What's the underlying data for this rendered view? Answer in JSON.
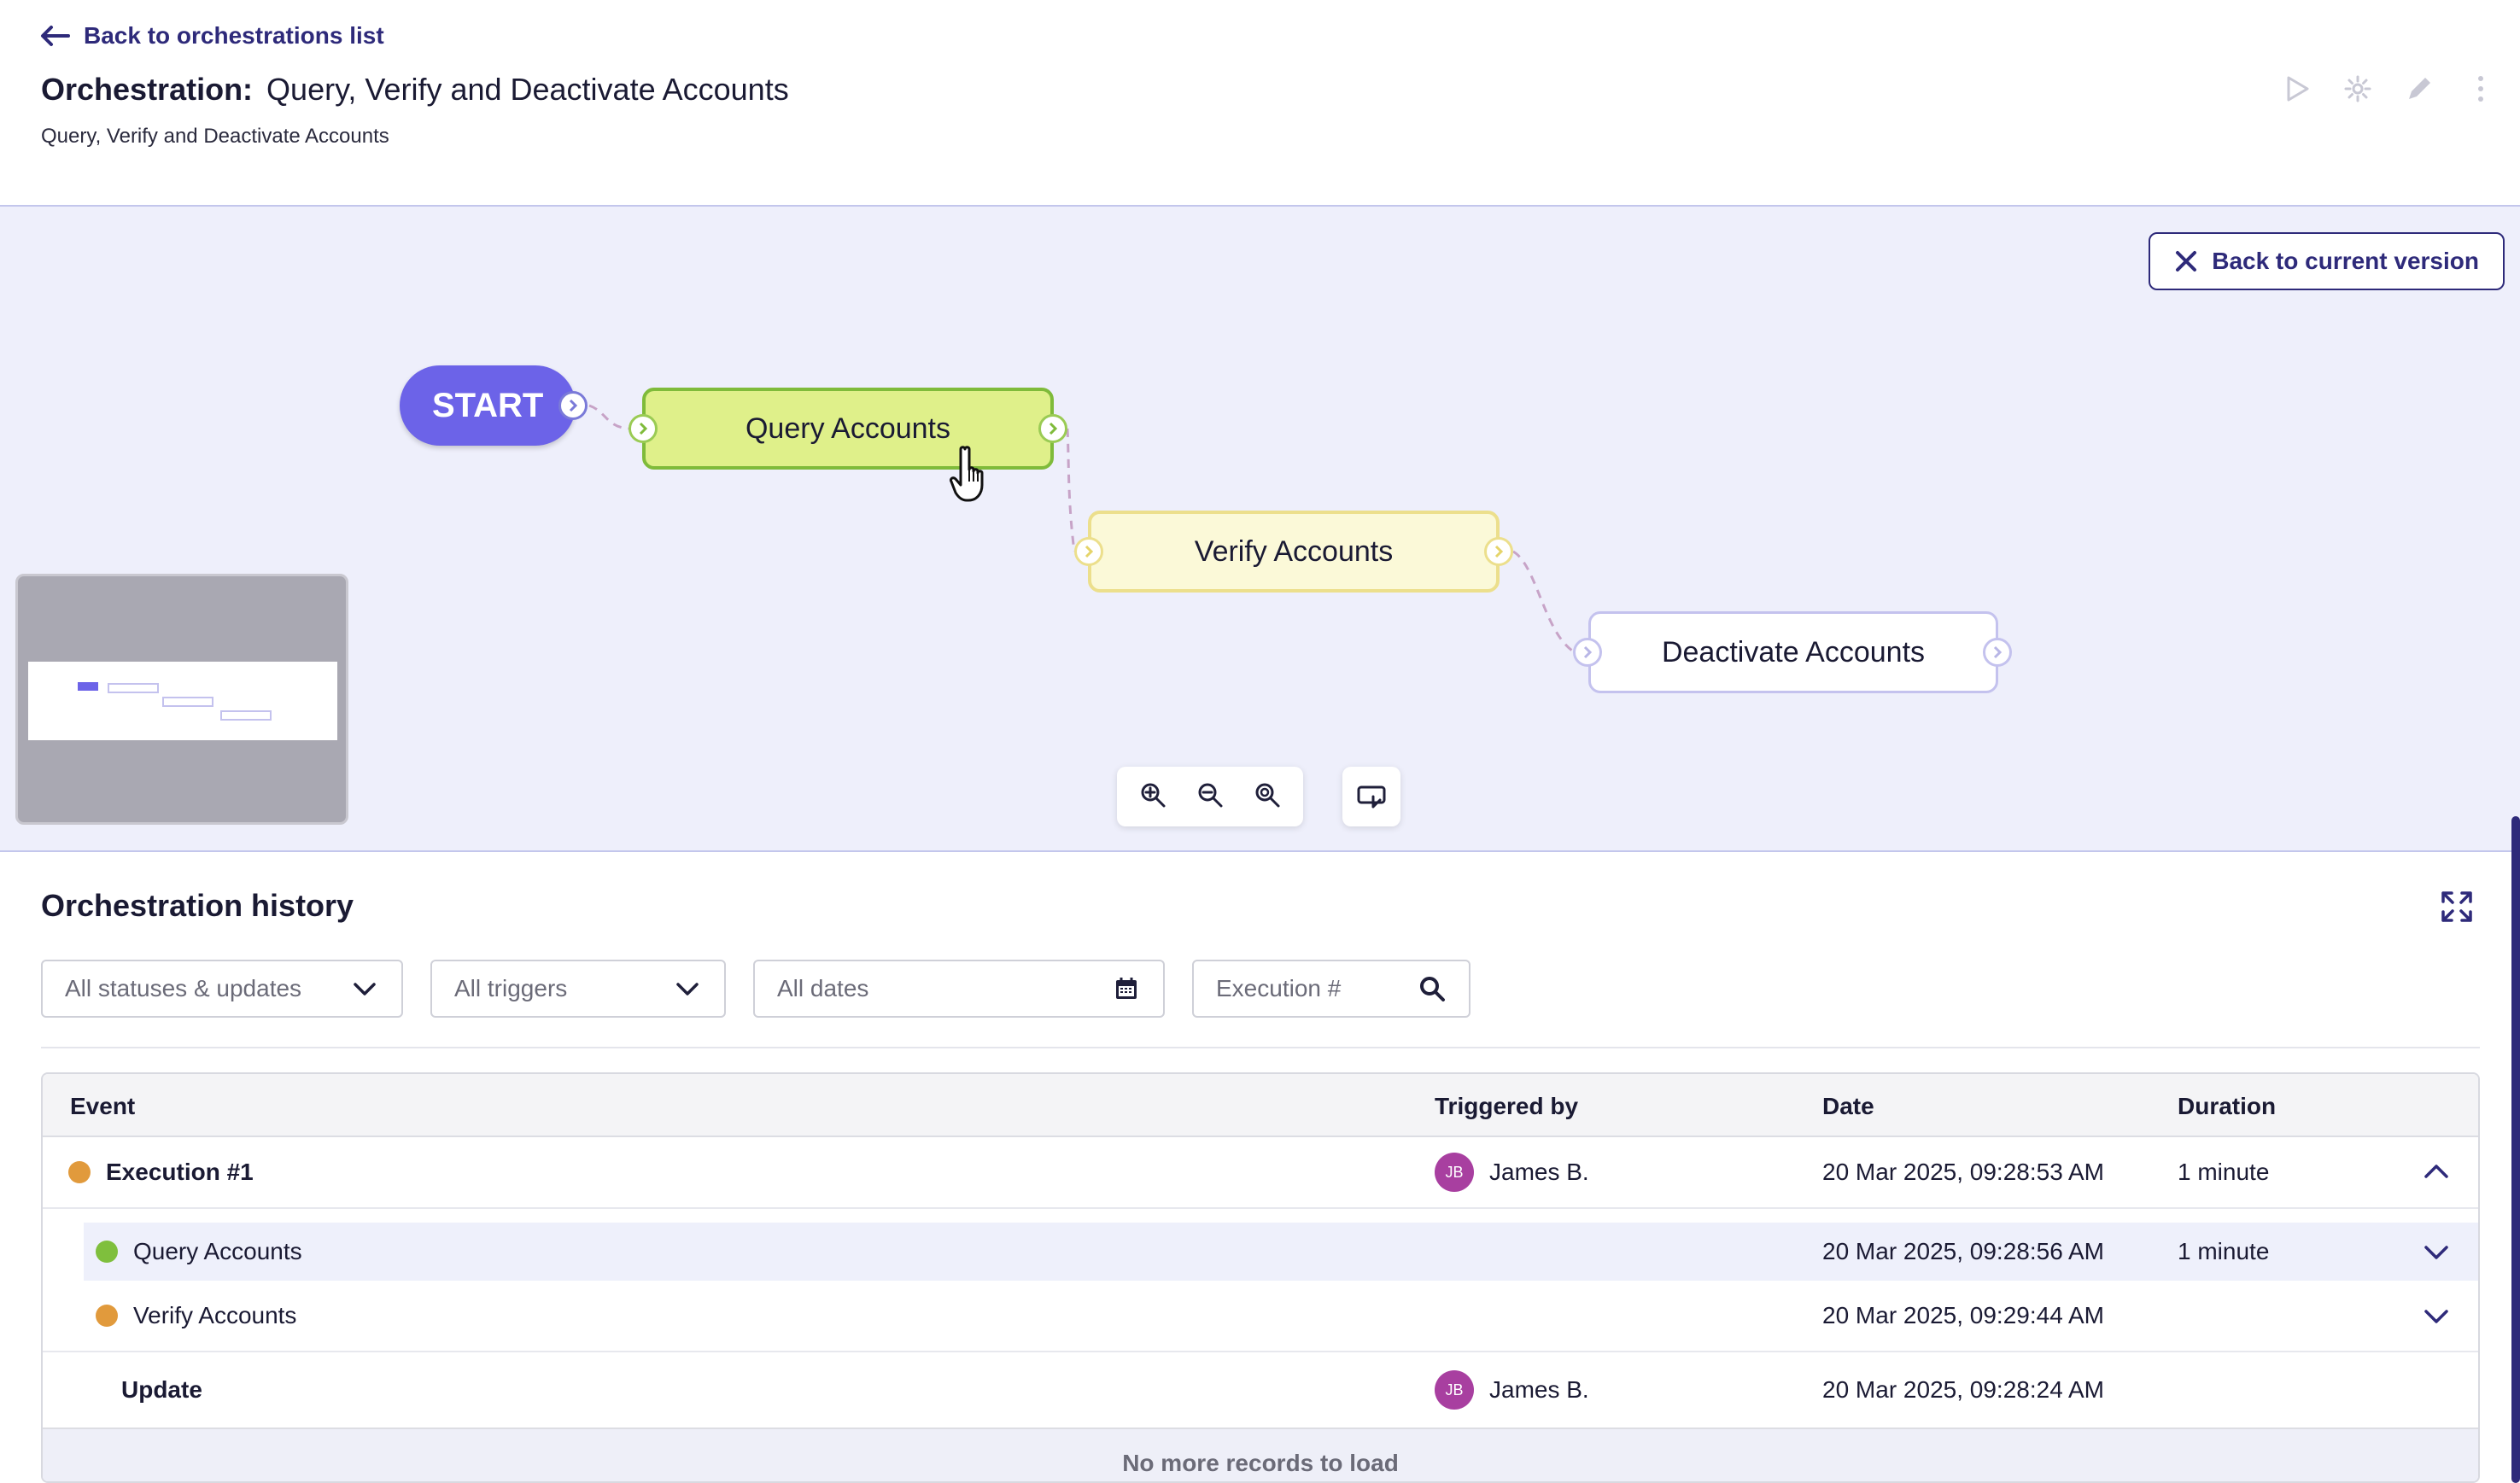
{
  "header": {
    "back_label": "Back to orchestrations list",
    "title_label": "Orchestration:",
    "title_value": "Query, Verify and Deactivate Accounts",
    "subtitle": "Query, Verify and Deactivate Accounts",
    "actions": [
      "play-icon",
      "gear-icon",
      "pencil-icon",
      "more-vertical-icon"
    ]
  },
  "canvas": {
    "back_version_label": "Back to current version",
    "start_label": "START",
    "nodes": [
      {
        "label": "Query Accounts",
        "status": "success",
        "color": "#dff08a"
      },
      {
        "label": "Verify Accounts",
        "status": "running",
        "color": "#fbf9d8"
      },
      {
        "label": "Deactivate Accounts",
        "status": "pending",
        "color": "#ffffff"
      }
    ],
    "zoom_controls": [
      "zoom-in-icon",
      "zoom-out-icon",
      "zoom-reset-icon"
    ],
    "fit_control": "fit-screen-icon"
  },
  "history": {
    "title": "Orchestration history",
    "filters": {
      "status": "All statuses & updates",
      "triggers": "All triggers",
      "dates": "All dates",
      "execution_placeholder": "Execution #"
    },
    "columns": {
      "event": "Event",
      "triggered_by": "Triggered by",
      "date": "Date",
      "duration": "Duration"
    },
    "rows": [
      {
        "event": "Execution #1",
        "status_color": "#e19a3c",
        "initials": "JB",
        "user": "James B.",
        "date": "20 Mar 2025, 09:28:53 AM",
        "duration": "1 minute",
        "expanded": true,
        "children": [
          {
            "event": "Query Accounts",
            "status_color": "#7fbf3d",
            "date": "20 Mar 2025, 09:28:56 AM",
            "duration": "1 minute"
          },
          {
            "event": "Verify Accounts",
            "status_color": "#e19a3c",
            "date": "20 Mar 2025, 09:29:44 AM",
            "duration": ""
          }
        ]
      },
      {
        "event": "Update",
        "initials": "JB",
        "user": "James B.",
        "date": "20 Mar 2025, 09:28:24 AM",
        "duration": ""
      }
    ],
    "no_more": "No more records to load"
  },
  "colors": {
    "accent": "#2e2a7a",
    "start": "#6c63e8",
    "canvas_bg": "#eeeffb"
  }
}
